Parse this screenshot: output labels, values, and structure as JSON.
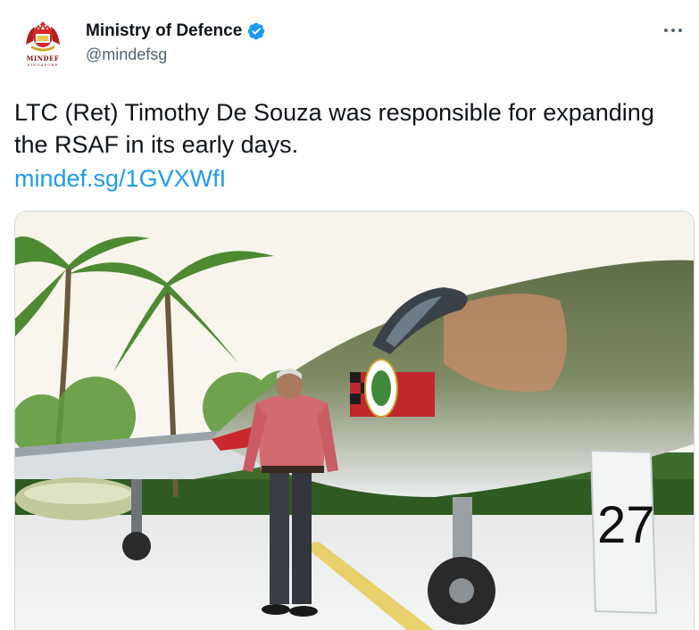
{
  "tweet": {
    "author": {
      "display_name": "Ministry of Defence",
      "handle": "@mindefsg",
      "verified": true,
      "avatar_logo_text": "MINDEF",
      "avatar_logo_subtext": "SINGAPORE"
    },
    "text": "LTC (Ret) Timothy De Souza was responsible for expanding the RSAF in its early days.",
    "link_text": "mindef.sg/1GVXWfI",
    "media": {
      "aircraft_number": "27"
    },
    "more_icon": "more-horizontal-icon"
  },
  "colors": {
    "link": "#1d9bf0",
    "verified": "#1d9bf0",
    "handle": "#536471",
    "text": "#0f1419"
  }
}
